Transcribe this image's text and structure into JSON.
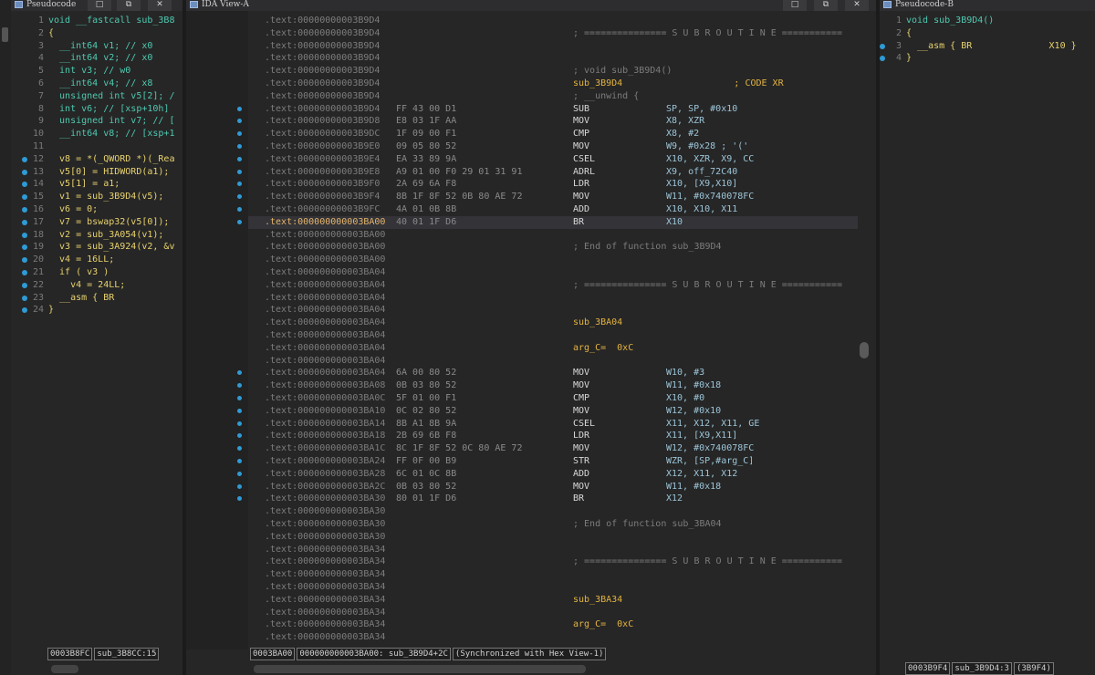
{
  "panes": {
    "pseudo_a": {
      "title": "Pseudocode",
      "lines": [
        {
          "n": "1",
          "t": "void __fastcall sub_3B8"
        },
        {
          "n": "2",
          "t": "{"
        },
        {
          "n": "3",
          "t": "  __int64 v1; // x0"
        },
        {
          "n": "4",
          "t": "  __int64 v2; // x0"
        },
        {
          "n": "5",
          "t": "  int v3; // w0"
        },
        {
          "n": "6",
          "t": "  __int64 v4; // x8"
        },
        {
          "n": "7",
          "t": "  unsigned int v5[2]; /"
        },
        {
          "n": "8",
          "t": "  int v6; // [xsp+10h]"
        },
        {
          "n": "9",
          "t": "  unsigned int v7; // ["
        },
        {
          "n": "10",
          "t": "  __int64 v8; // [xsp+1"
        },
        {
          "n": "11",
          "t": ""
        },
        {
          "n": "12",
          "t": "  v8 = *(_QWORD *)(_Rea"
        },
        {
          "n": "13",
          "t": "  v5[0] = HIDWORD(a1);"
        },
        {
          "n": "14",
          "t": "  v5[1] = a1;"
        },
        {
          "n": "15",
          "t": "  v1 = sub_3B9D4(v5);"
        },
        {
          "n": "16",
          "t": "  v6 = 0;"
        },
        {
          "n": "17",
          "t": "  v7 = bswap32(v5[0]);"
        },
        {
          "n": "18",
          "t": "  v2 = sub_3A054(v1);"
        },
        {
          "n": "19",
          "t": "  v3 = sub_3A924(v2, &v"
        },
        {
          "n": "20",
          "t": "  v4 = 16LL;"
        },
        {
          "n": "21",
          "t": "  if ( v3 )"
        },
        {
          "n": "22",
          "t": "    v4 = 24LL;"
        },
        {
          "n": "23",
          "t": "  __asm { BR"
        },
        {
          "n": "24",
          "t": "}"
        }
      ],
      "status": [
        "0003B8FC",
        "sub_3B8CC:15"
      ]
    },
    "ida": {
      "title": "IDA View-A",
      "rows": [
        {
          "addr": ".text:00000000003B9D4",
          "bytes": "",
          "ins": "",
          "ops": ""
        },
        {
          "addr": ".text:00000000003B9D4",
          "bytes": "",
          "ins": "; =============== S U B R O U T I N E ===========",
          "ops": ""
        },
        {
          "addr": ".text:00000000003B9D4",
          "bytes": "",
          "ins": "",
          "ops": ""
        },
        {
          "addr": ".text:00000000003B9D4",
          "bytes": "",
          "ins": "",
          "ops": ""
        },
        {
          "addr": ".text:00000000003B9D4",
          "bytes": "",
          "ins": "; void sub_3B9D4()",
          "ops": ""
        },
        {
          "addr": ".text:00000000003B9D4",
          "bytes": "",
          "ins": "sub_3B9D4",
          "ops": "                    ; CODE XR"
        },
        {
          "addr": ".text:00000000003B9D4",
          "bytes": "",
          "ins": "; __unwind {",
          "ops": ""
        },
        {
          "addr": ".text:00000000003B9D4",
          "bytes": "FF 43 00 D1",
          "ins": "SUB",
          "ops": "SP, SP, #0x10"
        },
        {
          "addr": ".text:00000000003B9D8",
          "bytes": "E8 03 1F AA",
          "ins": "MOV",
          "ops": "X8, XZR"
        },
        {
          "addr": ".text:00000000003B9DC",
          "bytes": "1F 09 00 F1",
          "ins": "CMP",
          "ops": "X8, #2"
        },
        {
          "addr": ".text:00000000003B9E0",
          "bytes": "09 05 80 52",
          "ins": "MOV",
          "ops": "W9, #0x28 ; '('"
        },
        {
          "addr": ".text:00000000003B9E4",
          "bytes": "EA 33 89 9A",
          "ins": "CSEL",
          "ops": "X10, XZR, X9, CC"
        },
        {
          "addr": ".text:00000000003B9E8",
          "bytes": "A9 01 00 F0 29 01 31 91",
          "ins": "ADRL",
          "ops": "X9, off_72C40"
        },
        {
          "addr": ".text:00000000003B9F0",
          "bytes": "2A 69 6A F8",
          "ins": "LDR",
          "ops": "X10, [X9,X10]"
        },
        {
          "addr": ".text:00000000003B9F4",
          "bytes": "8B 1F 8F 52 0B 80 AE 72",
          "ins": "MOV",
          "ops": "W11, #0x740078FC"
        },
        {
          "addr": ".text:00000000003B9FC",
          "bytes": "4A 01 0B 8B",
          "ins": "ADD",
          "ops": "X10, X10, X11"
        },
        {
          "addr": ".text:000000000003BA00",
          "bytes": "40 01 1F D6",
          "ins": "BR",
          "ops": "X10"
        },
        {
          "addr": ".text:000000000003BA00",
          "bytes": "",
          "ins": "",
          "ops": ""
        },
        {
          "addr": ".text:000000000003BA00",
          "bytes": "",
          "ins": "; End of function sub_3B9D4",
          "ops": ""
        },
        {
          "addr": ".text:000000000003BA00",
          "bytes": "",
          "ins": "",
          "ops": ""
        },
        {
          "addr": ".text:000000000003BA04",
          "bytes": "",
          "ins": "",
          "ops": ""
        },
        {
          "addr": ".text:000000000003BA04",
          "bytes": "",
          "ins": "; =============== S U B R O U T I N E ===========",
          "ops": ""
        },
        {
          "addr": ".text:000000000003BA04",
          "bytes": "",
          "ins": "",
          "ops": ""
        },
        {
          "addr": ".text:000000000003BA04",
          "bytes": "",
          "ins": "",
          "ops": ""
        },
        {
          "addr": ".text:000000000003BA04",
          "bytes": "",
          "ins": "sub_3BA04",
          "ops": ""
        },
        {
          "addr": ".text:000000000003BA04",
          "bytes": "",
          "ins": "",
          "ops": ""
        },
        {
          "addr": ".text:000000000003BA04",
          "bytes": "",
          "ins": "arg_C=  0xC",
          "ops": ""
        },
        {
          "addr": ".text:000000000003BA04",
          "bytes": "",
          "ins": "",
          "ops": ""
        },
        {
          "addr": ".text:000000000003BA04",
          "bytes": "6A 00 80 52",
          "ins": "MOV",
          "ops": "W10, #3"
        },
        {
          "addr": ".text:000000000003BA08",
          "bytes": "0B 03 80 52",
          "ins": "MOV",
          "ops": "W11, #0x18"
        },
        {
          "addr": ".text:000000000003BA0C",
          "bytes": "5F 01 00 F1",
          "ins": "CMP",
          "ops": "X10, #0"
        },
        {
          "addr": ".text:000000000003BA10",
          "bytes": "0C 02 80 52",
          "ins": "MOV",
          "ops": "W12, #0x10"
        },
        {
          "addr": ".text:000000000003BA14",
          "bytes": "8B A1 8B 9A",
          "ins": "CSEL",
          "ops": "X11, X12, X11, GE"
        },
        {
          "addr": ".text:000000000003BA18",
          "bytes": "2B 69 6B F8",
          "ins": "LDR",
          "ops": "X11, [X9,X11]"
        },
        {
          "addr": ".text:000000000003BA1C",
          "bytes": "8C 1F 8F 52 0C 80 AE 72",
          "ins": "MOV",
          "ops": "W12, #0x740078FC"
        },
        {
          "addr": ".text:000000000003BA24",
          "bytes": "FF 0F 00 B9",
          "ins": "STR",
          "ops": "WZR, [SP,#arg_C]"
        },
        {
          "addr": ".text:000000000003BA28",
          "bytes": "6C 01 0C 8B",
          "ins": "ADD",
          "ops": "X12, X11, X12"
        },
        {
          "addr": ".text:000000000003BA2C",
          "bytes": "0B 03 80 52",
          "ins": "MOV",
          "ops": "W11, #0x18"
        },
        {
          "addr": ".text:000000000003BA30",
          "bytes": "80 01 1F D6",
          "ins": "BR",
          "ops": "X12"
        },
        {
          "addr": ".text:000000000003BA30",
          "bytes": "",
          "ins": "",
          "ops": ""
        },
        {
          "addr": ".text:000000000003BA30",
          "bytes": "",
          "ins": "; End of function sub_3BA04",
          "ops": ""
        },
        {
          "addr": ".text:000000000003BA30",
          "bytes": "",
          "ins": "",
          "ops": ""
        },
        {
          "addr": ".text:000000000003BA34",
          "bytes": "",
          "ins": "",
          "ops": ""
        },
        {
          "addr": ".text:000000000003BA34",
          "bytes": "",
          "ins": "; =============== S U B R O U T I N E ===========",
          "ops": ""
        },
        {
          "addr": ".text:000000000003BA34",
          "bytes": "",
          "ins": "",
          "ops": ""
        },
        {
          "addr": ".text:000000000003BA34",
          "bytes": "",
          "ins": "",
          "ops": ""
        },
        {
          "addr": ".text:000000000003BA34",
          "bytes": "",
          "ins": "sub_3BA34",
          "ops": ""
        },
        {
          "addr": ".text:000000000003BA34",
          "bytes": "",
          "ins": "",
          "ops": ""
        },
        {
          "addr": ".text:000000000003BA34",
          "bytes": "",
          "ins": "arg_C=  0xC",
          "ops": ""
        },
        {
          "addr": ".text:000000000003BA34",
          "bytes": "",
          "ins": "",
          "ops": ""
        }
      ],
      "status": [
        "0003BA00",
        "000000000003BA00: sub_3B9D4+2C",
        "(Synchronized with Hex View-1)"
      ]
    },
    "pseudo_b": {
      "title": "Pseudocode-B",
      "lines": [
        {
          "n": "1",
          "t": "void sub_3B9D4()"
        },
        {
          "n": "2",
          "t": "{"
        },
        {
          "n": "3",
          "t": "  __asm { BR              X10 }"
        },
        {
          "n": "4",
          "t": "}"
        }
      ],
      "status": [
        "0003B9F4",
        "sub_3B9D4:3",
        "(3B9F4)"
      ]
    }
  },
  "window_buttons": [
    "□",
    "⧉",
    "✕"
  ]
}
